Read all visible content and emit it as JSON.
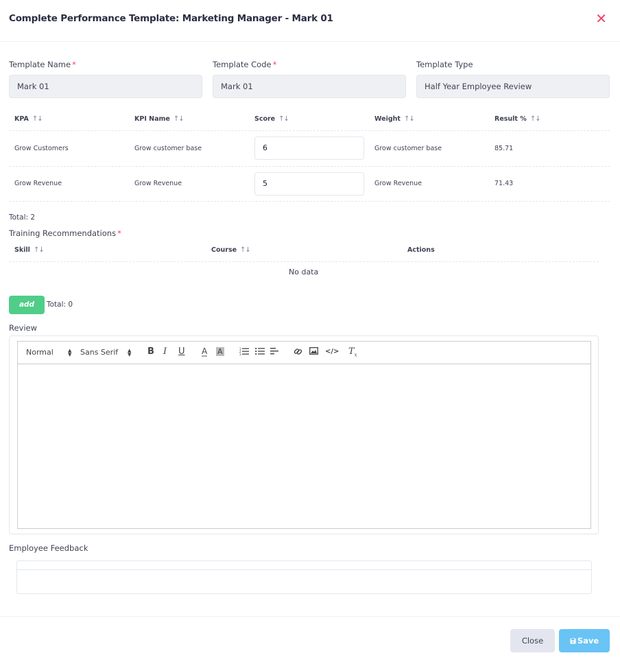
{
  "modal": {
    "title": "Complete Performance Template: Marketing Manager - Mark 01",
    "close_glyph": "✕"
  },
  "fields": {
    "template_name_label": "Template Name",
    "template_name_value": "Mark 01",
    "template_code_label": "Template Code",
    "template_code_value": "Mark 01",
    "template_type_label": "Template Type",
    "template_type_value": "Half Year Employee Review",
    "required_mark": "*"
  },
  "kpi_table": {
    "headers": [
      "KPA",
      "KPI Name",
      "Score",
      "Weight",
      "Result %"
    ],
    "sort_glyph": "↑↓",
    "rows": [
      {
        "kpa": "Grow Customers",
        "kpi_name": "Grow customer base",
        "score": "6",
        "weight": "Grow customer base",
        "result": "85.71"
      },
      {
        "kpa": "Grow Revenue",
        "kpi_name": "Grow Revenue",
        "score": "5",
        "weight": "Grow Revenue",
        "result": "71.43"
      }
    ],
    "total": "Total: 2"
  },
  "training": {
    "label": "Training Recommendations",
    "headers": [
      "Skill",
      "Course",
      "Actions"
    ],
    "empty": "No data",
    "add_label": "add",
    "total": "Total: 0"
  },
  "review": {
    "label": "Review",
    "toolbar": {
      "size_select": "Normal",
      "font_select": "Sans Serif"
    }
  },
  "feedback": {
    "label": "Employee Feedback"
  },
  "footer": {
    "close_label": "Close",
    "save_label": "Save"
  },
  "colors": {
    "required": "#f1416c",
    "add_button": "#50cd89",
    "save_button": "#69c3f5",
    "close_button": "#e4e6ef"
  }
}
